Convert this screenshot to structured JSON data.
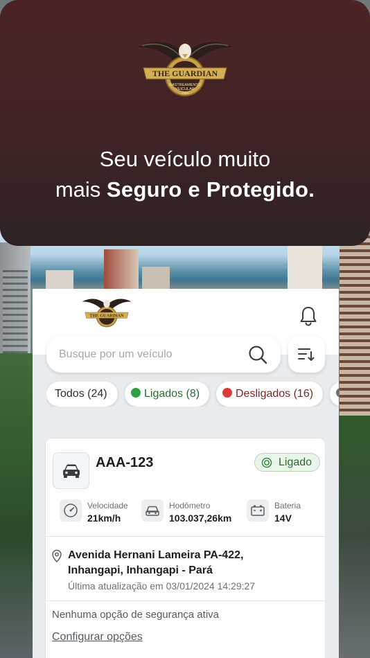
{
  "colors": {
    "brand_dark": "#4d2426",
    "ligado_green": "#2ea043",
    "desligado_red": "#d93a3a",
    "gold": "#c8a04a"
  },
  "hero": {
    "logo_icon": "the-guardian-eagle-logo",
    "logo_text": "THE GUARDIAN",
    "logo_subtext": "RASTREAMENTO VEICULAR 24H",
    "tagline_line1": "Seu veículo muito",
    "tagline_line2_prefix": "mais ",
    "tagline_line2_bold": "Seguro e Protegido."
  },
  "header": {
    "logo_icon": "the-guardian-eagle-logo",
    "bell_icon": "bell-icon"
  },
  "search": {
    "placeholder": "Busque por um veículo",
    "search_icon": "search-icon",
    "sort_icon": "sort-icon"
  },
  "filters": [
    {
      "label": "Todos (24)",
      "dot": ""
    },
    {
      "label": "Ligados (8)",
      "dot": "green"
    },
    {
      "label": "Desligados (16)",
      "dot": "red"
    }
  ],
  "vehicle": {
    "icon": "car-icon",
    "plate": "AAA-123",
    "status": "Ligado",
    "metrics": [
      {
        "icon": "speedometer-icon",
        "label": "Velocidade",
        "value": "21km/h"
      },
      {
        "icon": "odometer-icon",
        "label": "Hodômetro",
        "value": "103.037,26km"
      },
      {
        "icon": "battery-icon",
        "label": "Bateria",
        "value": "14V"
      }
    ],
    "address": "Avenida Hernani Lameira PA-422, Inhangapi, Inhangapi - Pará",
    "last_update": "Última atualização em 03/01/2024 14:29:27",
    "security_text": "Nenhuma opção de segurança ativa",
    "configure_link": "Configurar opções"
  }
}
